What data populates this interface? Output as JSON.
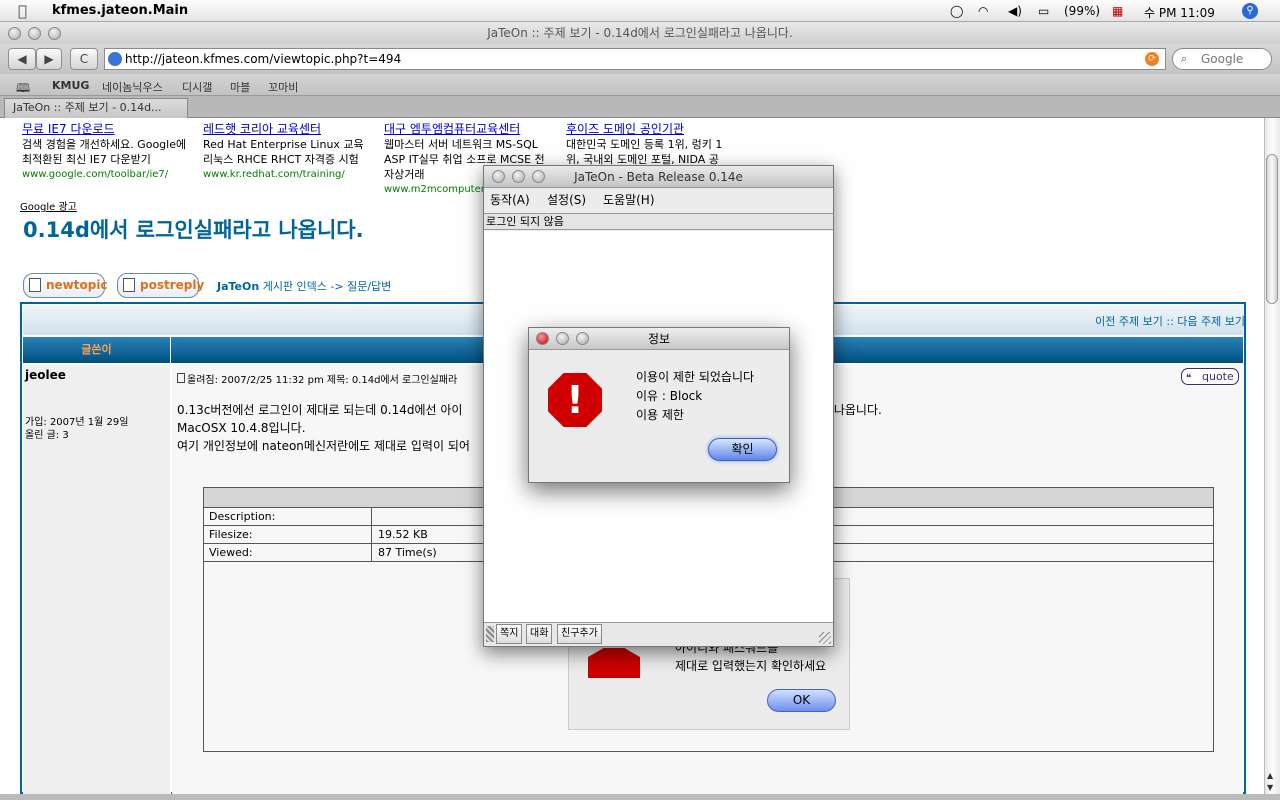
{
  "menubar": {
    "apple_icon": "apple-icon",
    "app_name": "kfmes.jateon.Main",
    "battery": "(99%)",
    "clock": "수 PM 11:09"
  },
  "browser": {
    "window_title": "JaTeOn :: 주제 보기 - 0.14d에서 로그인실패라고 나옵니다.",
    "back": "◀",
    "forward": "▶",
    "reload": "C",
    "url": "http://jateon.kfmes.com/viewtopic.php?t=494",
    "search_placeholder": "Google",
    "bookmarks": [
      "KMUG",
      "네이놈닉우스",
      "디시갤",
      "마블",
      "꼬마비"
    ],
    "tab_label": "JaTeOn :: 주제 보기 - 0.14d..."
  },
  "ads": [
    {
      "title": "무료 IE7 다운로드",
      "line1": "검색 경험을 개선하세요. Google에",
      "line2": "최적환된 최신 IE7 다운받기",
      "url": "www.google.com/toolbar/ie7/"
    },
    {
      "title": "레드햇 코리아 교육센터",
      "line1": "Red Hat Enterprise Linux 교육",
      "line2": "리눅스 RHCE RHCT 자격증 시험",
      "url": "www.kr.redhat.com/training/"
    },
    {
      "title": "대구 엠투엠컴퓨터교육센터",
      "line1": "웹마스터 서버 네트워크 MS-SQL",
      "line2": "ASP IT실무 취업 소프로 MCSE 전",
      "line3": "자상거래",
      "url": "www.m2mcomputer"
    },
    {
      "title": "후이즈 도메인 공인기관",
      "line1": "대한민국 도메인 등록 1위, 렁키 1",
      "line2": "위, 국내외 도메인 포털, NIDA 공"
    }
  ],
  "google_ad_label": "Google 광고",
  "topic_title": "0.14d에서 로그인실패라고 나옵니다.",
  "buttons": {
    "newtopic": "newtopic",
    "postreply": "postreply"
  },
  "breadcrumb": {
    "site": "JaTeOn",
    "rest": "게시판 인덱스 -> 질문/답변"
  },
  "nav_links": "이전 주제 보기 :: 다음 주제 보기",
  "thead_author": "글쓴이",
  "post": {
    "author": "jeolee",
    "joined": "가입: 2007년 1월 29일",
    "posts": "올린 글: 3",
    "meta": "올려짐: 2007/2/25 11:32 pm     제목: 0.14d에서 로그인실패라",
    "quote": "quote",
    "body1": "0.13c버전에선 로그인이 제대로 되는데 0.14d에선 아이",
    "body1b": "고 나옵니다.",
    "body2": "MacOSX 10.4.8입니다.",
    "body3": "여기 개인정보에 nateon메신저란에도 제대로 입력이 되어"
  },
  "attachment": {
    "description_label": "Description:",
    "filesize_label": "Filesize:",
    "filesize_value": "19.52 KB",
    "viewed_label": "Viewed:",
    "viewed_value": "87 Time(s)",
    "img_line1": "아이디와 패스워드를",
    "img_line2": "제대로 입력했는지 확인하세요",
    "img_ok": "OK"
  },
  "jateon": {
    "title": "JaTeOn - Beta Release 0.14e",
    "menu": [
      "동작(A)",
      "설정(S)",
      "도움말(H)"
    ],
    "status": "로그인 되지 않음",
    "bottom_buttons": [
      "쪽지",
      "대화",
      "친구추가"
    ]
  },
  "dialog": {
    "title": "정보",
    "line1": "이용이 제한 되었습니다",
    "line2": "이유 : Block",
    "line3": "이용 제한",
    "ok": "확인",
    "icon": "stop-icon"
  },
  "colors": {
    "accent": "#006699",
    "header_orange": "#ffa34f",
    "stop_red": "#d10000"
  }
}
